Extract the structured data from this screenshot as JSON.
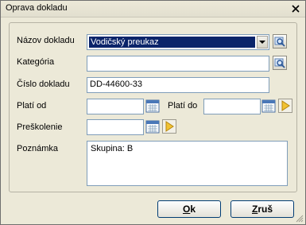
{
  "window": {
    "title": "Oprava dokladu"
  },
  "form": {
    "doc_name_label": "Názov dokladu",
    "doc_name_value": "Vodičský preukaz",
    "category_label": "Kategória",
    "category_value": "",
    "doc_number_label": "Číslo dokladu",
    "doc_number_value": "DD-44600-33",
    "valid_from_label": "Platí od",
    "valid_from_value": "",
    "valid_to_label": "Platí do",
    "valid_to_value": "",
    "training_label": "Preškolenie",
    "training_value": "",
    "note_label": "Poznámka",
    "note_value": "Skupina: B"
  },
  "buttons": {
    "ok_underlined": "O",
    "ok_rest": "k",
    "cancel_underlined": "Z",
    "cancel_rest": "ruš"
  },
  "icons": [
    "close-icon",
    "dropdown-arrow-icon",
    "search-icon",
    "calendar-icon",
    "arrow-right-icon",
    "resize-grip-icon"
  ],
  "colors": {
    "selection_bg": "#0a246a",
    "dialog_bg": "#ece9d8",
    "input_border": "#7f9db9"
  }
}
